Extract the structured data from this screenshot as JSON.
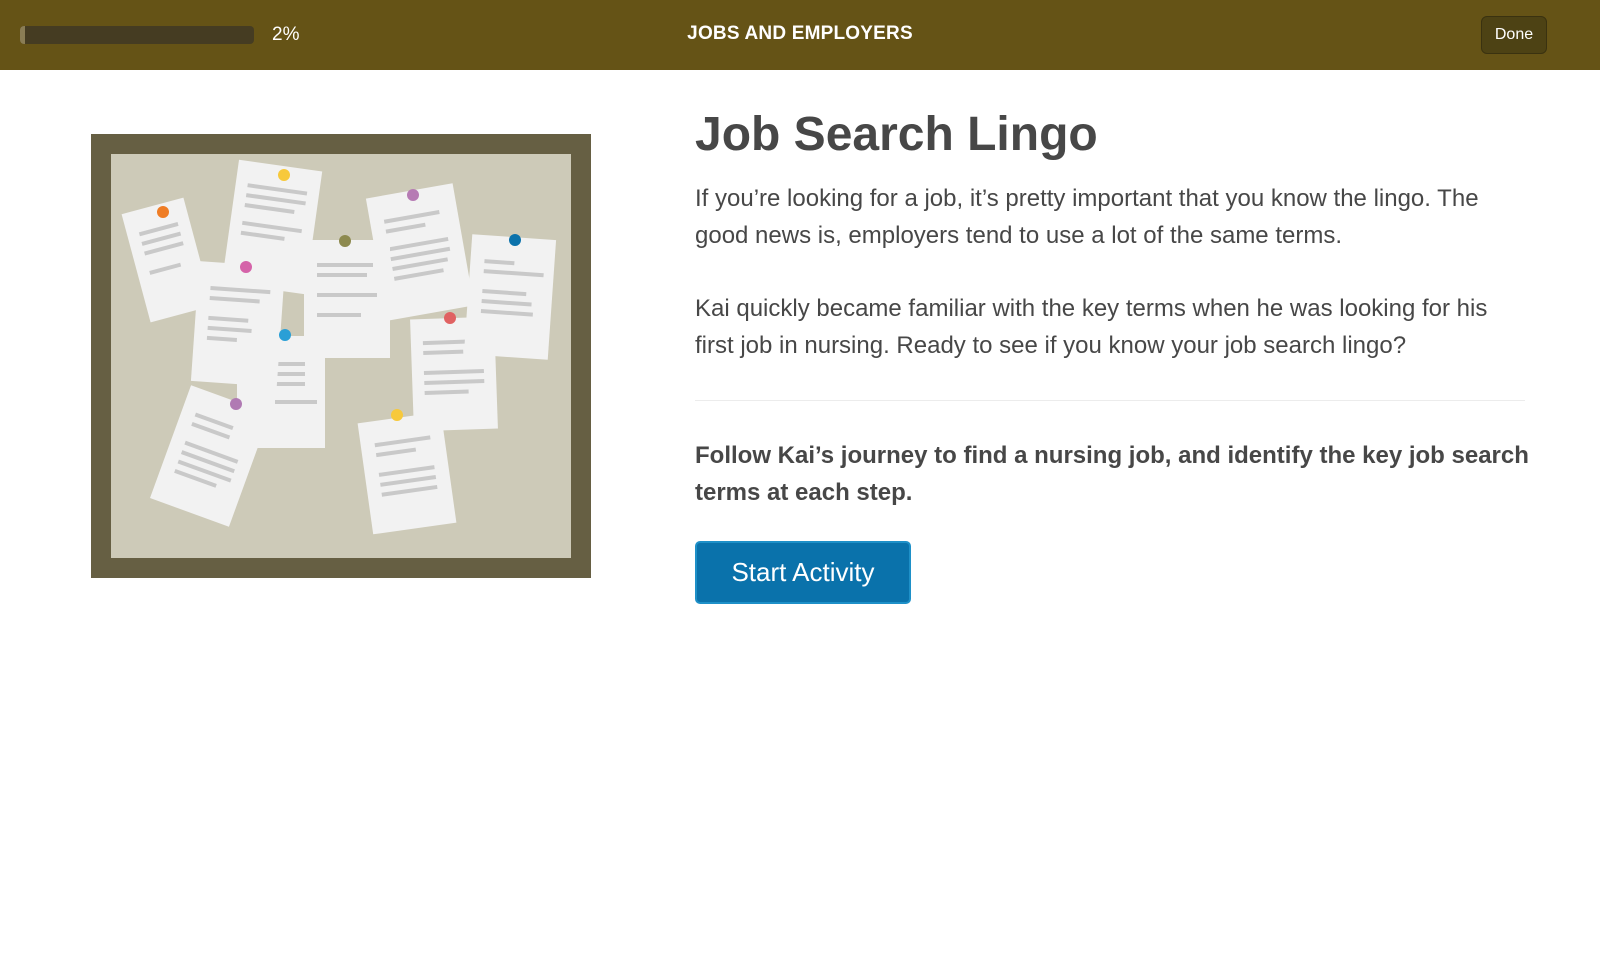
{
  "header": {
    "progress_percent": 2,
    "progress_label": "2%",
    "title": "JOBS AND EMPLOYERS",
    "done_label": "Done"
  },
  "main": {
    "title": "Job Search Lingo",
    "intro": "If you’re looking for a job, it’s pretty important that you know the lingo. The good news is, employers tend to use a lot of the same terms.",
    "story": "Kai quickly became familiar with the key terms when he was looking for his first job in nursing. Ready to see if you know your job search lingo?",
    "instruction": "Follow Kai’s journey to find a nursing job, and identify the key job search terms at each step.",
    "start_label": "Start Activity"
  },
  "illustration": {
    "subject": "bulletin-board-illustration",
    "colors": {
      "frame": "#665f43",
      "cork": "#cdcab8",
      "paper": "#f2f2f2",
      "line": "#c9c9c9",
      "pins": [
        "#ef7d25",
        "#f7c93b",
        "#b67bb4",
        "#8d8a4f",
        "#0b72ab",
        "#d563a9",
        "#2a9fd6",
        "#e06262",
        "#b07ab3",
        "#f7c93b"
      ]
    }
  },
  "colors": {
    "topbar": "#655316",
    "button": "#0a72ab",
    "text": "#474747"
  }
}
